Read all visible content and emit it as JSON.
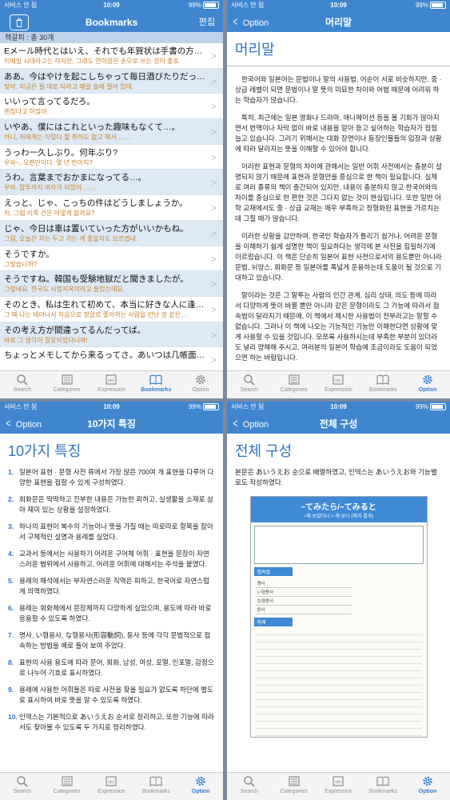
{
  "status": {
    "carrier": "서비스 안 됨",
    "time": "10:09",
    "battery": "99%"
  },
  "tabs": [
    "Search",
    "Categories",
    "Expression",
    "Bookmarks",
    "Option"
  ],
  "bookmarks_screen": {
    "title": "Bookmarks",
    "edit": "편집",
    "count": "책갈피 : 총 30개",
    "items": [
      {
        "jp": "Eメール時代とはいえ、それでも年賀状は手書の方…",
        "ko": "이메일 시대라고는 하지만, 그래도 연하장은 손으로 쓰는 것이 좋죠"
      },
      {
        "jp": "ああ。今はやけを起こしちゃって毎日酒びたりだっ…",
        "ko": "맞아. 지금은 될 대로 되라고 매일 술에 절어 있대."
      },
      {
        "jp": "いいって言ってるだろ。",
        "ko": "괜찮다고 하잖아."
      },
      {
        "jp": "いやあ、僕にはこれといった趣味もなくて…。",
        "ko": "아니, 저에게는 이렇다 할 취미도 없고 해서 ……."
      },
      {
        "jp": "うっわー久しぶり。何年ぶり?",
        "ko": "우와~, 오랜만이다. 몇 년 만이지?"
      },
      {
        "jp": "うわ。言葉までおかまになってる…。",
        "ko": "우와. 말투까지 여자가 되었어 ……."
      },
      {
        "jp": "えっと、じゃ、こっちの件はどうしましょうか。",
        "ko": "저, 그럼 이쪽 건은 어떻게 할까요?"
      },
      {
        "jp": "じゃ、今日は車は置いていった方がいいかもね。",
        "ko": "그럼, 오늘은 차는 두고 가는 게 좋을지도 모르겠네."
      },
      {
        "jp": "そうですか。",
        "ko": "그렇습니까?"
      },
      {
        "jp": "そうですね。韓国も受験地獄だと聞きましたが。",
        "ko": "그렇네요. 한국도 시험지옥이라고 들었는데요."
      },
      {
        "jp": "そのとき、私は生れて初めて、本当に好きな人に逢…",
        "ko": "그 때 나는 태어나서 처음으로 정말로 좋아하는 사람을 만난 것 같은…"
      },
      {
        "jp": "その考え方が間違ってるんだってば。",
        "ko": "바로 그 생각이 잘못되었다니까!"
      },
      {
        "jp": "ちょっとメモしてから来るってさ。あいつは几帳面…",
        "ko": ""
      }
    ]
  },
  "preface_screen": {
    "back": "Option",
    "title": "머리말",
    "heading": "머리말",
    "paragraphs": [
      "한국어와 일본어는 문법이나 말의 사용법, 어순이 서로 비슷하지만, 중 · 상급 레벨이 되면 문법이나 말 뜻의 미묘한 차이와 어법 때문에 어려워 하는 학습자가 많습니다.",
      "특히, 최근에는 일본 영화나 드라마, 애니메이션 등을 볼 기회가 많아지면서 번역이나 자막 없이 바로 내용을 알아 듣고 싶어하는 학습자가 점점 늘고 있습니다. 그러기 위해서는 대화 장면이나 동장인물들의 입장과 상황에 따라 달라지는 뜻을 이해할 수 있어야 합니다.",
      "이러한 표현과 문형의 차이에 관해서는 일반 어휘 사전에서는 충분이 설명되지 않기 때문에 표현과 문형만을 중심으로 한 책이 필요합니다. 실제로 여러 종류의 책이 출간되어 있지만, 내용이 충분하지 않고 한국어와의 차이를 중심으로 한 편한 것은 그다지 없는 것이 현실입니다. 또한 일반 어학 교재에서도 중 · 상급 교재는 매우 부족하고 정형화된 표현을 가르치는 데 그칠 때가 많습니다.",
      "이러한 상황을 감안하여, 한국인 학습자가 틀리기 쉽거나, 어려운 문형을 이해하기 쉽게 설명한 책이 필요하다는 생각에 본 사전을 집필하기에 이르렀습니다. 이 책은 단순히 일본어 표현 사전으로서의 용도뿐만 아니라 문법, 뉘앙스, 회화문 등 일본어를 폭넓게 운용하는데 도움이 될 것으로 기대하고 있습니다.",
      "말이라는 것은 그 말투는 사람의 인간 관계, 심리 상태, 의도 등에 따라서 다양하게 뜻이 바뀔 뿐만 아니라 같은 문형이라도 그 기능에 따라서 접속법이 달라지기 때문에, 이 책에서 제시한 사용법이 전부라고는 말할 수 없습니다. 그러나 이 책에 나오는 기능적인 기능만 이해한다면 상황에 맞게 사용할 수 있을 것입니다. 모쪼록 사용하시는데 부족한 부분이 있더라도 널리 양해해 주시고, 여러분의 일본어 학습에 조금이라도 도움이 되었으면 하는 바람입니다."
    ]
  },
  "features_screen": {
    "back": "Option",
    "title": "10가지 특징",
    "heading": "10가지 특징",
    "items": [
      "일본어 표현 · 문형 사전 류에서 가장 많은 700여 개 표현을 다루어 다양한 표현을 접할 수 있게 구성하였다.",
      "회화문은 딱딱하고 진부한 내용은 가능한 피하고, 실생활을 소재로 삼아 재미 있는 상황을 설정하였다.",
      "하나의 표현이 복수의 기능이나 뜻을 가질 때는 따로따로 항목을 잡아서 구체적인 설명과 용례를 실었다.",
      "교과서 등에서는 사용하기 어려운 구어체 어휘 · 표현을 문장이 자연스러운 범위에서 사용하고, 어려운 어휘에 대해서는 주석을 붙였다.",
      "용례의 해석에서는 부자연스러운 직역은 피하고, 한국어로 자연스럽게 의역하였다.",
      "용례는 회화체에서 문장체까지 다양하게 실었으며, 용도에 따라 바로 응용할 수 있도록 하였다.",
      "명사, い형용사, な형용사(形容動詞), 동사 등에 각각 문법적으로 접속하는 방법을 예로 들어 보여 주었다.",
      "표현의 사용 용도에 따라 문어, 회화, 남성, 여성, 포멀, 인포멀, 감정으로 나누어 기호로 표시하였다.",
      "용례에 사용한 어휘들은 따로 사전을 찾을 필요가 없도록 하단에 별도로 표시하여 바로 뜻을 알 수 있도록 하였다.",
      "인덱스는 기본적으로 あいうえお 순서로 정리하고, 또한 기능에 따라서도 찾아볼 수 있도록 두 가지로 정리하였다."
    ]
  },
  "structure_screen": {
    "back": "Option",
    "title": "전체 구성",
    "heading": "전체 구성",
    "intro": "본문은 あいうえお 순으로 배열하였고, 인덱스는 あいうえお와 기능별로도 작성하였다.",
    "sample": {
      "title": "~てみたら/~てみると",
      "subtitle": "~해 보았더니 /~해 보니 (해가 결과)",
      "label1": "접속법",
      "label2": "용례",
      "rows": [
        "명사",
        "い형용사",
        "な형용사",
        "동사"
      ]
    }
  }
}
